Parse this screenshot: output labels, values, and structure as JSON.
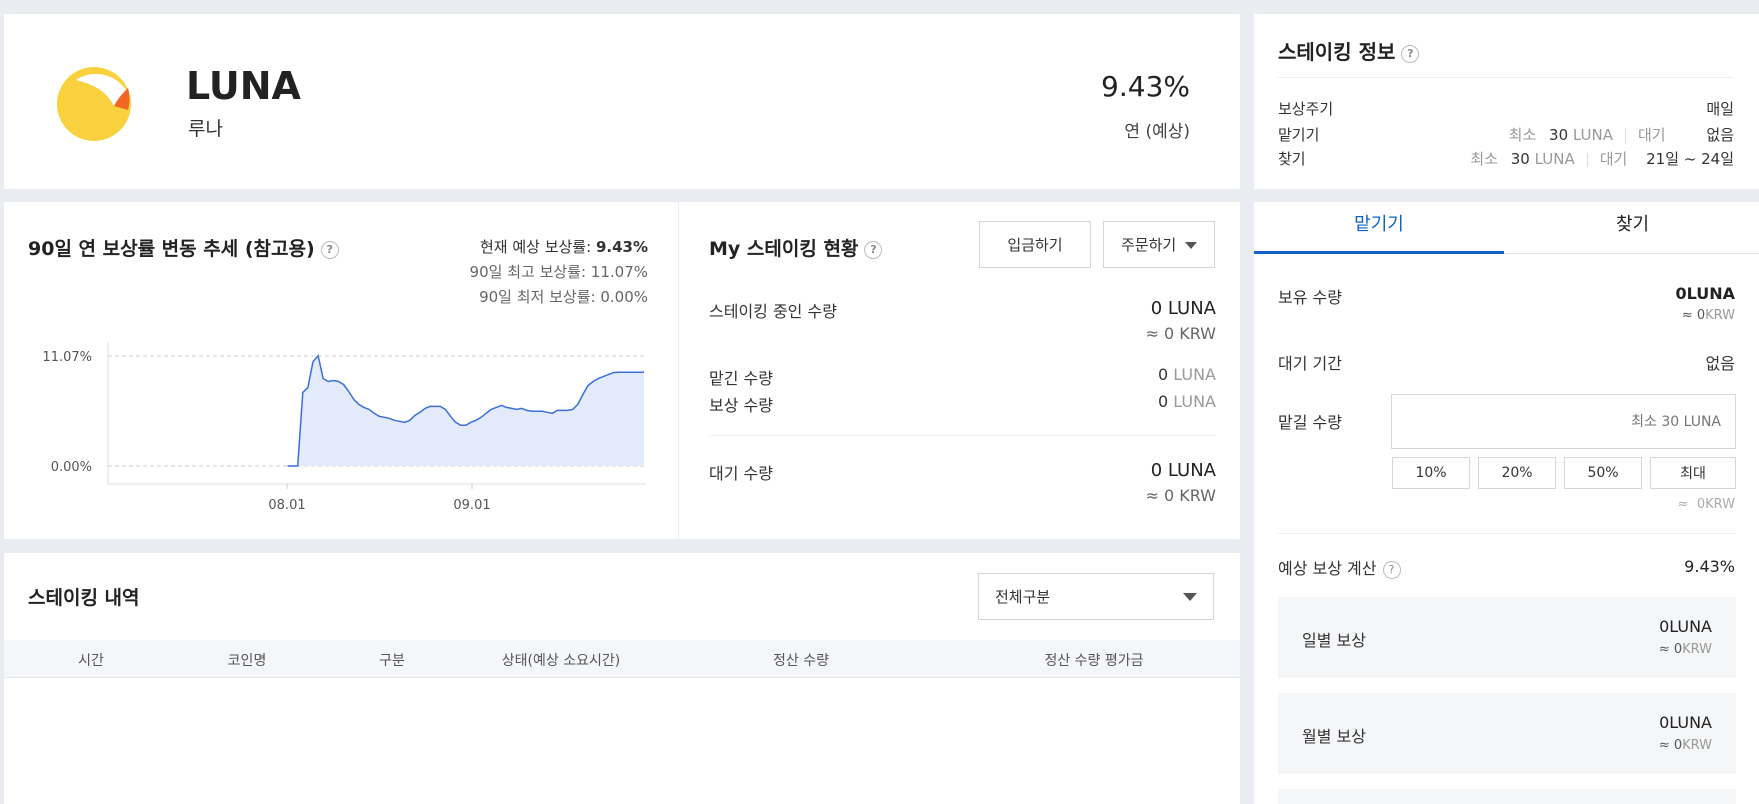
{
  "coin": {
    "symbol": "LUNA",
    "name": "루나",
    "rate": "9.43%",
    "rate_label": "연 (예상)"
  },
  "staking_info": {
    "title": "스테이킹 정보",
    "help": "?",
    "reward_cycle_label": "보상주기",
    "reward_cycle_value": "매일",
    "deposit_label": "맡기기",
    "withdraw_label": "찾기",
    "min_label": "최소",
    "min_amount": "30",
    "unit": "LUNA",
    "wait_label": "대기",
    "deposit_wait": "없음",
    "withdraw_wait": "21일 ~ 24일"
  },
  "trend": {
    "title": "90일 연 보상률 변동 추세 (참고용)",
    "help": "?",
    "current_label": "현재 예상 보상률:",
    "current_value": "9.43%",
    "max_text": "90일 최고 보상률: 11.07%",
    "min_text": "90일 최저 보상률: 0.00%"
  },
  "chart_data": {
    "type": "area",
    "y_ticks": [
      "11.07%",
      "0.00%"
    ],
    "x_ticks": [
      "08.01",
      "09.01"
    ],
    "ylim": [
      0,
      11.07
    ],
    "series": [
      {
        "x": [
          0,
          1,
          2,
          3,
          4,
          5,
          6,
          7,
          8,
          9,
          10,
          11,
          12,
          13,
          14,
          15,
          16,
          17,
          18,
          19,
          20,
          21,
          22,
          23,
          24,
          25,
          26,
          27,
          28,
          29,
          30,
          31,
          32,
          33,
          34,
          35,
          36,
          37,
          38,
          39,
          40,
          41,
          42,
          43,
          44,
          45,
          46,
          47,
          48,
          49,
          50,
          51,
          52,
          53,
          54,
          55,
          56,
          57,
          58,
          59,
          60,
          61,
          62,
          63,
          64,
          65,
          66,
          67,
          68,
          69,
          70
        ],
        "values": [
          0,
          0,
          0,
          7.4,
          7.9,
          10.5,
          11.1,
          8.8,
          8.5,
          8.6,
          8.5,
          8.2,
          7.5,
          6.7,
          6.2,
          5.9,
          5.7,
          5.3,
          5.0,
          4.9,
          4.8,
          4.6,
          4.5,
          4.4,
          4.6,
          5.1,
          5.4,
          5.8,
          6.0,
          6.0,
          6.0,
          5.7,
          5.0,
          4.4,
          4.1,
          4.1,
          4.4,
          4.6,
          4.9,
          5.3,
          5.7,
          5.9,
          6.1,
          5.9,
          5.8,
          5.7,
          5.8,
          5.6,
          5.5,
          5.5,
          5.5,
          5.4,
          5.3,
          5.6,
          5.6,
          5.6,
          5.7,
          6.2,
          7.2,
          8.1,
          8.5,
          8.8,
          9.0,
          9.2,
          9.4,
          9.43,
          9.43,
          9.43,
          9.43,
          9.43,
          9.43
        ]
      }
    ],
    "colors": {
      "line": "#3a6fd8",
      "fill": "#e3eafa"
    },
    "grid": "dashed-horizontal"
  },
  "my_staking": {
    "title": "My 스테이킹 현황",
    "help": "?",
    "deposit_button": "입금하기",
    "order_button": "주문하기",
    "staking_label": "스테이킹 중인 수량",
    "staking_value": "0 LUNA",
    "staking_krw": "≈ 0 KRW",
    "deposited_label": "맡긴 수량",
    "deposited_value": "0",
    "deposited_unit": "LUNA",
    "reward_label": "보상 수량",
    "reward_value": "0",
    "reward_unit": "LUNA",
    "waiting_label": "대기 수량",
    "waiting_value": "0 LUNA",
    "waiting_krw": "≈ 0 KRW"
  },
  "history": {
    "title": "스테이킹 내역",
    "filter_value": "전체구분",
    "columns": [
      "시간",
      "코인명",
      "구분",
      "상태(예상 소요시간)",
      "정산 수량",
      "정산 수량 평가금"
    ]
  },
  "trade": {
    "tabs": [
      "맡기기",
      "찾기"
    ],
    "holding_label": "보유 수량",
    "holding_value": "0",
    "holding_unit": "LUNA",
    "holding_krw_prefix": "≈ 0",
    "holding_krw_unit": "KRW",
    "wait_period_label": "대기 기간",
    "wait_period_value": "없음",
    "amount_label": "맡길 수량",
    "amount_placeholder": "최소 30 LUNA",
    "pct_buttons": [
      "10%",
      "20%",
      "50%",
      "최대"
    ],
    "amount_krw": "≈  0KRW",
    "calc_label": "예상 보상 계산",
    "calc_help": "?",
    "calc_rate": "9.43%",
    "daily_label": "일별 보상",
    "daily_value": "0",
    "daily_unit": "LUNA",
    "daily_krw_prefix": "≈ 0",
    "daily_krw_unit": "KRW",
    "monthly_label": "월별 보상",
    "monthly_value": "0",
    "monthly_unit": "LUNA",
    "monthly_krw_prefix": "≈ 0",
    "monthly_krw_unit": "KRW"
  }
}
